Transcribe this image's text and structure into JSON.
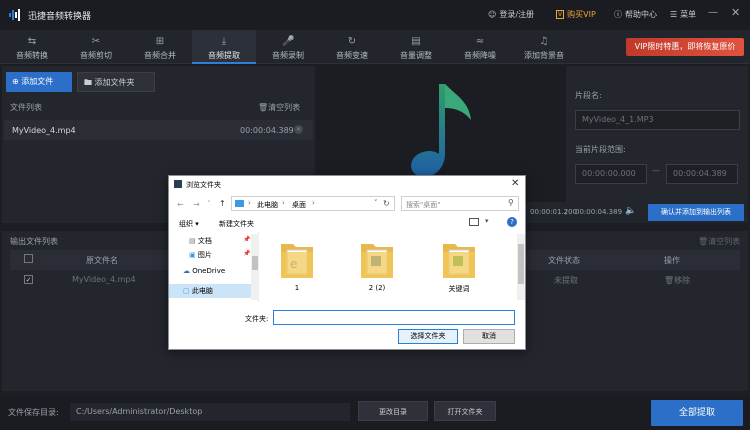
{
  "app": {
    "title": "迅捷音频转换器"
  },
  "titlebar": {
    "login": "登录/注册",
    "vip": "购买VIP",
    "help": "帮助中心",
    "menu": "菜单"
  },
  "tabs": [
    {
      "label": "音频转换",
      "icon": "convert-icon"
    },
    {
      "label": "音频剪切",
      "icon": "scissors-icon"
    },
    {
      "label": "音频合并",
      "icon": "merge-icon"
    },
    {
      "label": "音频提取",
      "icon": "extract-icon",
      "active": true
    },
    {
      "label": "音频录制",
      "icon": "mic-icon"
    },
    {
      "label": "音频变速",
      "icon": "speed-icon"
    },
    {
      "label": "音量调整",
      "icon": "volume-icon"
    },
    {
      "label": "音频降噪",
      "icon": "denoise-icon"
    },
    {
      "label": "添加背景音",
      "icon": "bgm-icon"
    }
  ],
  "vip_banner": "VIP限时特惠，即将恢复原价",
  "left": {
    "add_file": "添加文件",
    "add_folder": "添加文件夹",
    "file_list": "文件列表",
    "clear_list": "清空列表",
    "file_name": "MyVideo_4.mp4",
    "file_duration": "00:00:04.389"
  },
  "right": {
    "segment_name_label": "片段名:",
    "segment_name_value": "MyVideo_4_1.MP3",
    "range_label": "当前片段范围:",
    "range_start": "00:00:00.000",
    "range_end": "00:00:04.389"
  },
  "playbar": {
    "current": "00:00:01.200",
    "separator": "/",
    "total": "00:00:04.389",
    "confirm": "确认并添加到输出列表"
  },
  "output": {
    "title": "输出文件列表",
    "clear": "清空列表",
    "col_source": "原文件名",
    "col_status": "文件状态",
    "col_action": "操作",
    "row_name": "MyVideo_4.mp4",
    "row_status": "未提取",
    "row_action": "移除"
  },
  "bottom": {
    "dir_label": "文件保存目录:",
    "dir_value": "C:/Users/Administrator/Desktop",
    "change_dir": "更改目录",
    "open_folder": "打开文件夹",
    "extract_all": "全部提取"
  },
  "dialog": {
    "title": "浏览文件夹",
    "path_pc": "此电脑",
    "path_desktop": "桌面",
    "search_placeholder": "搜索\"桌面\"",
    "organize": "组织",
    "new_folder": "新建文件夹",
    "nav_items": [
      "文档",
      "图片",
      "OneDrive",
      "此电脑"
    ],
    "folders": [
      "1",
      "2 (2)",
      "关键词"
    ],
    "folder_label": "文件夹:",
    "folder_value": "",
    "select_btn": "选择文件夹",
    "cancel_btn": "取消"
  },
  "colors": {
    "accent": "#2b6fc8",
    "vip": "#e8a33a",
    "banner": "#d9443a"
  }
}
